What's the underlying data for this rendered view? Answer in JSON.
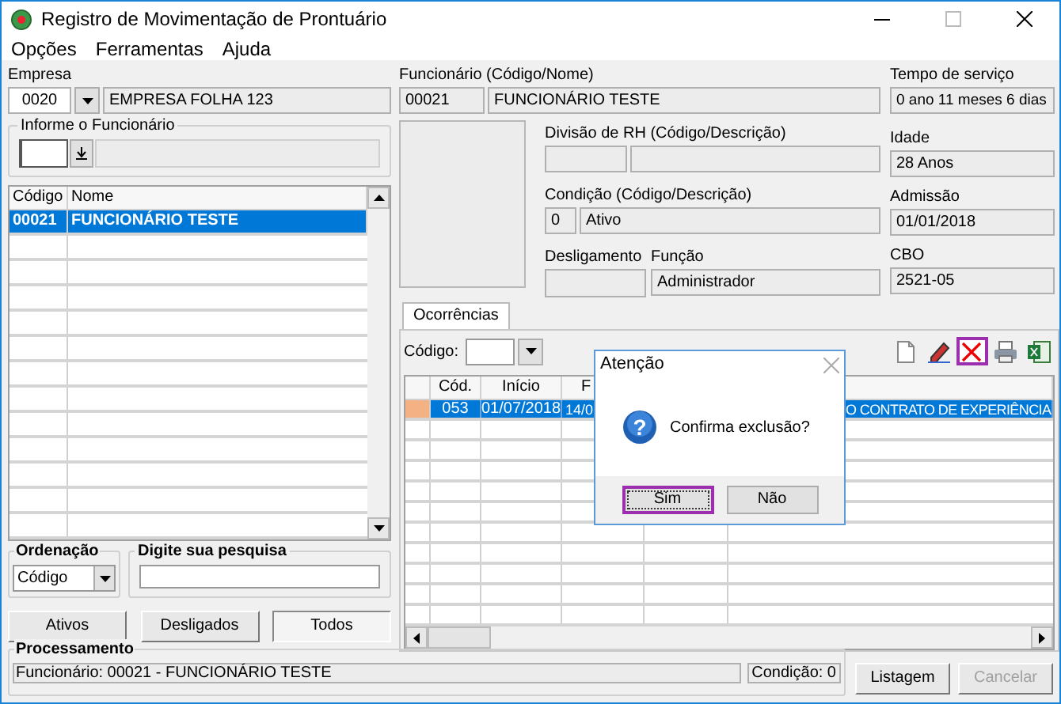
{
  "window": {
    "title": "Registro de Movimentação de Prontuário"
  },
  "menu": [
    "Opções",
    "Ferramentas",
    "Ajuda"
  ],
  "empresa": {
    "label": "Empresa",
    "code": "0020",
    "name": "EMPRESA FOLHA 123"
  },
  "lookup": {
    "label": "Informe o Funcionário"
  },
  "employee_list": {
    "columns": [
      "Código",
      "Nome"
    ],
    "rows": [
      {
        "cells": [
          "00021",
          "FUNCIONÁRIO TESTE"
        ],
        "selected": true
      }
    ]
  },
  "ordenacao": {
    "label": "Ordenação",
    "value": "Código"
  },
  "pesquisa": {
    "label": "Digite sua pesquisa"
  },
  "filter_buttons": [
    {
      "label": "Ativos",
      "selected": false
    },
    {
      "label": "Desligados",
      "selected": false
    },
    {
      "label": "Todos",
      "selected": true
    }
  ],
  "funcionario": {
    "label": "Funcionário (Código/Nome)",
    "code": "00021",
    "name": "FUNCIONÁRIO TESTE"
  },
  "tempo_servico": {
    "label": "Tempo de serviço",
    "value": "0 ano 11 meses 6 dias"
  },
  "divisao": {
    "label": "Divisão de RH (Código/Descrição)"
  },
  "idade": {
    "label": "Idade",
    "value": "28 Anos"
  },
  "condicao": {
    "label": "Condição (Código/Descrição)",
    "code": "0",
    "description": "Ativo"
  },
  "admissao": {
    "label": "Admissão",
    "value": "01/01/2018"
  },
  "desligamento": {
    "label": "Desligamento"
  },
  "funcao": {
    "label": "Função",
    "value": "Administrador"
  },
  "cbo": {
    "label": "CBO",
    "value": "2521-05"
  },
  "ocorrencias": {
    "tab": "Ocorrências",
    "codigo_label": "Código:",
    "toolbar": [
      {
        "kind": "new",
        "selected": false
      },
      {
        "kind": "edit",
        "selected": false
      },
      {
        "kind": "delete",
        "selected": true
      },
      {
        "kind": "print",
        "selected": false
      },
      {
        "kind": "excel",
        "selected": false
      }
    ],
    "columns": [
      "Cód.",
      "Início",
      "F"
    ],
    "rows": [
      {
        "cells": [
          "053",
          "01/07/2018",
          "14/0",
          "O CONTRATO DE EXPERIÊNCIA"
        ],
        "selected": true
      }
    ]
  },
  "processamento": {
    "label": "Processamento",
    "text": "Funcionário: 00021 - FUNCIONÁRIO TESTE",
    "condicao": "Condição: 0"
  },
  "buttons": [
    {
      "label": "Listagem",
      "disabled": false
    },
    {
      "label": "Cancelar",
      "disabled": true
    }
  ],
  "dialog": {
    "title": "Atenção",
    "icon_glyph": "?",
    "message": "Confirma exclusão?",
    "buttons": [
      {
        "label": "Sim",
        "selected": true
      },
      {
        "label": "Não",
        "selected": false
      }
    ]
  }
}
